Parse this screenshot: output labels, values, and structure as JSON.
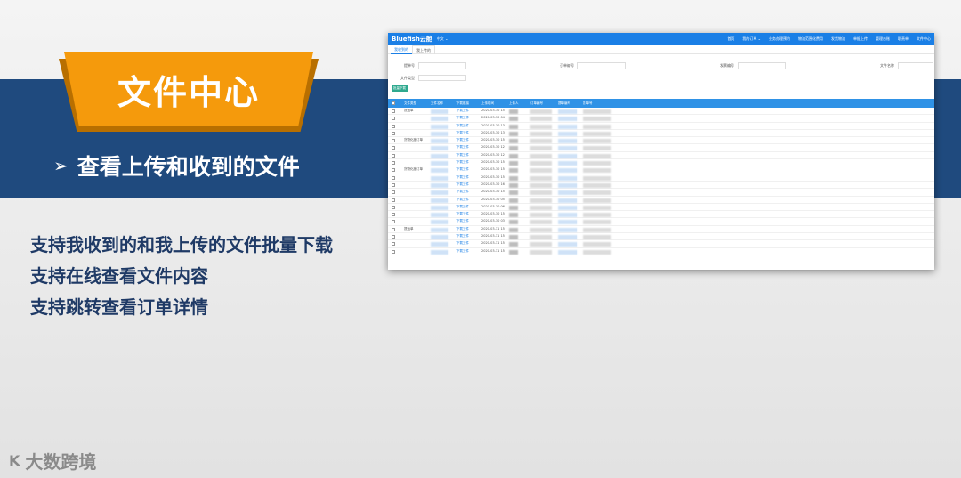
{
  "slide": {
    "title": "文件中心",
    "subtitle_arrow": "➢",
    "subtitle": "查看上传和收到的文件",
    "bullets": [
      "支持我收到的和我上传的文件批量下载",
      "支持在线查看文件内容",
      "支持跳转查看订单详情"
    ],
    "watermark": "大数跨境",
    "watermark_logo": "K"
  },
  "app": {
    "brand": "Bluefish云舱",
    "lang": "中文 ⌄",
    "nav": [
      "首页",
      "我的订单 ⌄",
      "业务办理预约",
      "物流范围化费用",
      "发货物流",
      "单据上传",
      "管理台账",
      "职责单",
      "文件中心"
    ],
    "tabs": [
      "我收到的",
      "我上传的"
    ],
    "filters": {
      "doc_no_label": "提单号",
      "order_no_label": "订单编号",
      "invoice_no_label": "发票编号",
      "file_name_label": "文件名称",
      "file_type_label": "文件类型"
    },
    "download_btn": "批量下载",
    "columns": [
      "文件类型",
      "文件名称",
      "下载链接",
      "上传时间",
      "上传人",
      "订单编号",
      "提单编号",
      "提单号"
    ],
    "rows": [
      {
        "type": "提运单",
        "link": "下载文件",
        "time": "2020-03-30 15"
      },
      {
        "type": "",
        "link": "下载文件",
        "time": "2020-03-30 04"
      },
      {
        "type": "",
        "link": "下载文件",
        "time": "2020-03-30 13"
      },
      {
        "type": "",
        "link": "下载文件",
        "time": "2020-03-30 13"
      },
      {
        "type": "货物化度订单",
        "link": "下载文件",
        "time": "2020-03-30 15"
      },
      {
        "type": "",
        "link": "下载文件",
        "time": "2020-03-30 12"
      },
      {
        "type": "",
        "link": "下载文件",
        "time": "2020-03-30 12"
      },
      {
        "type": "",
        "link": "下载文件",
        "time": "2020-03-30 15"
      },
      {
        "type": "货物化度订单",
        "link": "下载文件",
        "time": "2020-03-30 15"
      },
      {
        "type": "",
        "link": "下载文件",
        "time": "2020-03-30 15"
      },
      {
        "type": "",
        "link": "下载文件",
        "time": "2020-03-30 16"
      },
      {
        "type": "",
        "link": "下载文件",
        "time": "2020-03-30 15"
      },
      {
        "type": "",
        "link": "下载文件",
        "time": "2020-03-30 05"
      },
      {
        "type": "",
        "link": "下载文件",
        "time": "2020-03-30 06"
      },
      {
        "type": "",
        "link": "下载文件",
        "time": "2020-03-30 15"
      },
      {
        "type": "",
        "link": "下载文件",
        "time": "2020-03-30 03"
      },
      {
        "type": "提运单",
        "link": "下载文件",
        "time": "2020-03-31 15"
      },
      {
        "type": "",
        "link": "下载文件",
        "time": "2020-03-31 15"
      },
      {
        "type": "",
        "link": "下载文件",
        "time": "2020-03-31 15"
      },
      {
        "type": "",
        "link": "下载文件",
        "time": "2020-03-31 15"
      }
    ]
  }
}
